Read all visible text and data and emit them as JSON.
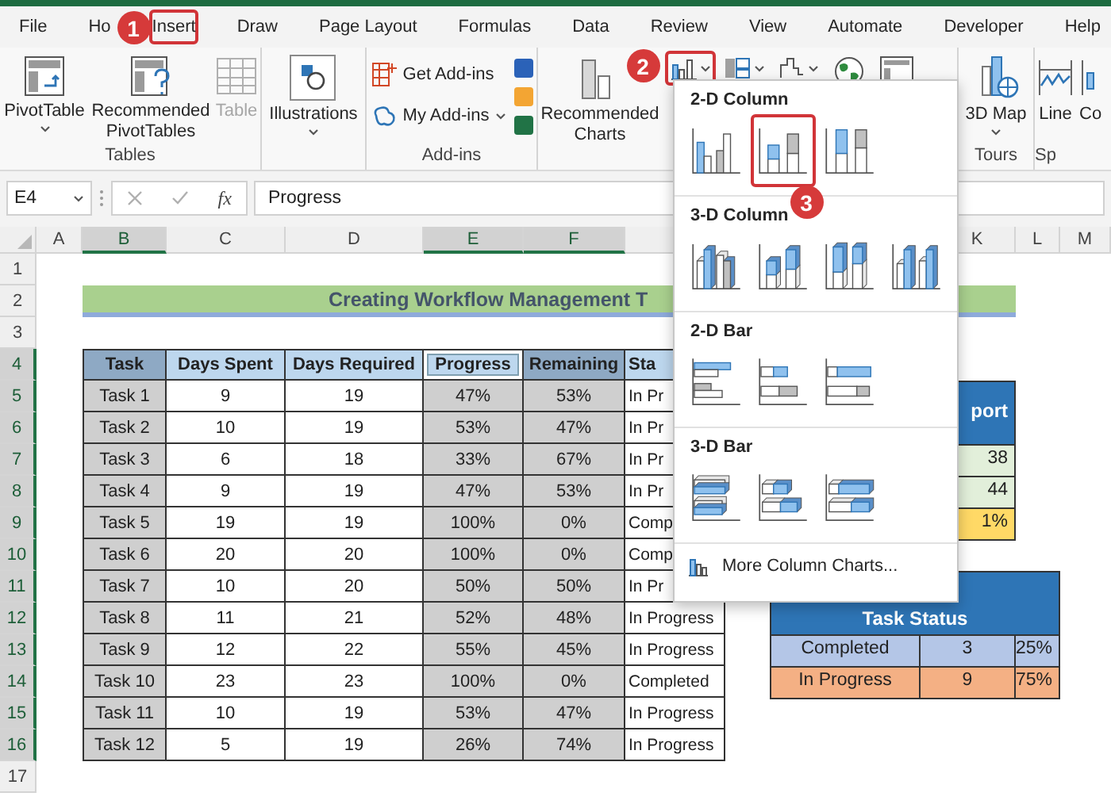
{
  "tabs": [
    {
      "label": "File",
      "selected": false
    },
    {
      "label": "Ho",
      "selected": false
    },
    {
      "label": "Insert",
      "selected": true
    },
    {
      "label": "Draw",
      "selected": false
    },
    {
      "label": "Page Layout",
      "selected": false
    },
    {
      "label": "Formulas",
      "selected": false
    },
    {
      "label": "Data",
      "selected": false
    },
    {
      "label": "Review",
      "selected": false
    },
    {
      "label": "View",
      "selected": false
    },
    {
      "label": "Automate",
      "selected": false
    },
    {
      "label": "Developer",
      "selected": false
    },
    {
      "label": "Help",
      "selected": false
    }
  ],
  "step_badges": [
    "1",
    "2",
    "3"
  ],
  "ribbon": {
    "groups": [
      {
        "kind": "tables",
        "label": "Tables",
        "buttons": [
          {
            "label": "PivotTable",
            "disabled": false
          },
          {
            "label": "Recommended PivotTables",
            "disabled": false
          },
          {
            "label": "Table",
            "disabled": true
          }
        ]
      },
      {
        "kind": "illustrations",
        "buttons": [
          {
            "label": "Illustrations",
            "disabled": false
          }
        ]
      },
      {
        "kind": "addins",
        "label": "Add-ins",
        "buttons": [
          {
            "label": "Get Add-ins",
            "disabled": false
          },
          {
            "label": "My Add-ins",
            "disabled": false
          }
        ]
      },
      {
        "kind": "charts",
        "column_chart_selected": true,
        "buttons": [
          {
            "label": "Recommended Charts",
            "disabled": false
          }
        ]
      },
      {
        "kind": "tours",
        "label": "Tours",
        "buttons": [
          {
            "label": "3D Map",
            "disabled": false
          }
        ]
      },
      {
        "kind": "sparklines",
        "label": "Sp",
        "buttons": [
          {
            "label": "Line",
            "disabled": false
          },
          {
            "label": "Co",
            "disabled": false
          }
        ]
      }
    ]
  },
  "formula_bar": {
    "name_box": "E4",
    "function_label": "fx",
    "formula": "Progress"
  },
  "sheet": {
    "column_headers": [
      {
        "label": "A",
        "selected": false
      },
      {
        "label": "B",
        "selected": true
      },
      {
        "label": "C",
        "selected": false
      },
      {
        "label": "D",
        "selected": false
      },
      {
        "label": "E",
        "selected": true
      },
      {
        "label": "F",
        "selected": true
      },
      {
        "label": "K",
        "selected": false
      },
      {
        "label": "L",
        "selected": false
      },
      {
        "label": "M",
        "selected": false
      }
    ],
    "row_headers": [
      {
        "label": "1",
        "selected": false
      },
      {
        "label": "2",
        "selected": false
      },
      {
        "label": "3",
        "selected": false
      },
      {
        "label": "4",
        "selected": true
      },
      {
        "label": "5",
        "selected": true
      },
      {
        "label": "6",
        "selected": true
      },
      {
        "label": "7",
        "selected": true
      },
      {
        "label": "8",
        "selected": true
      },
      {
        "label": "9",
        "selected": true
      },
      {
        "label": "10",
        "selected": true
      },
      {
        "label": "11",
        "selected": true
      },
      {
        "label": "12",
        "selected": true
      },
      {
        "label": "13",
        "selected": true
      },
      {
        "label": "14",
        "selected": true
      },
      {
        "label": "15",
        "selected": true
      },
      {
        "label": "16",
        "selected": true
      },
      {
        "label": "17",
        "selected": false
      }
    ],
    "title": "Creating Workflow Management T",
    "table": {
      "columns": [
        {
          "label": "Task",
          "selected": true,
          "active": false
        },
        {
          "label": "Days Spent",
          "selected": false,
          "active": false
        },
        {
          "label": "Days Required",
          "selected": false,
          "active": false
        },
        {
          "label": "Progress",
          "selected": true,
          "active": true
        },
        {
          "label": "Remaining",
          "selected": true,
          "active": false
        },
        {
          "label": "Sta",
          "selected": false,
          "active": false
        }
      ],
      "rows": [
        [
          "Task 1",
          "9",
          "19",
          "47%",
          "53%",
          "In Pr"
        ],
        [
          "Task 2",
          "10",
          "19",
          "53%",
          "47%",
          "In Pr"
        ],
        [
          "Task 3",
          "6",
          "18",
          "33%",
          "67%",
          "In Pr"
        ],
        [
          "Task 4",
          "9",
          "19",
          "47%",
          "53%",
          "In Pr"
        ],
        [
          "Task 5",
          "19",
          "19",
          "100%",
          "0%",
          "Comp"
        ],
        [
          "Task 6",
          "20",
          "20",
          "100%",
          "0%",
          "Comp"
        ],
        [
          "Task 7",
          "10",
          "20",
          "50%",
          "50%",
          "In Pr"
        ],
        [
          "Task 8",
          "11",
          "21",
          "52%",
          "48%",
          "In Progress"
        ],
        [
          "Task 9",
          "12",
          "22",
          "55%",
          "45%",
          "In Progress"
        ],
        [
          "Task 10",
          "23",
          "23",
          "100%",
          "0%",
          "Completed"
        ],
        [
          "Task 11",
          "10",
          "19",
          "53%",
          "47%",
          "In Progress"
        ],
        [
          "Task 12",
          "5",
          "19",
          "26%",
          "74%",
          "In Progress"
        ]
      ]
    },
    "report": {
      "header": "port",
      "rows": [
        {
          "value": "38",
          "color": "#e2efda"
        },
        {
          "value": "44",
          "color": "#e2efda"
        },
        {
          "value": "1%",
          "color": "#ffd966"
        }
      ]
    },
    "task_status": {
      "header": "Task Status",
      "rows": [
        {
          "label": "Completed",
          "count": "3",
          "share": "25%",
          "color": "#b4c6e7"
        },
        {
          "label": "In Progress",
          "count": "9",
          "share": "75%",
          "color": "#f4b084"
        }
      ]
    }
  },
  "chart_menu": {
    "sections": [
      {
        "title": "2-D Column",
        "charts": [
          {
            "kind": "colClustered",
            "selected": false
          },
          {
            "kind": "colStacked",
            "selected": true
          },
          {
            "kind": "colFull",
            "selected": false
          }
        ]
      },
      {
        "title": "3-D Column",
        "charts": [
          {
            "kind": "colClustered3d",
            "selected": false
          },
          {
            "kind": "colStacked3d",
            "selected": false
          },
          {
            "kind": "colFull3d",
            "selected": false
          },
          {
            "kind": "col3d",
            "selected": false
          }
        ]
      },
      {
        "title": "2-D Bar",
        "charts": [
          {
            "kind": "barClustered",
            "selected": false
          },
          {
            "kind": "barStacked",
            "selected": false
          },
          {
            "kind": "barFull",
            "selected": false
          }
        ]
      },
      {
        "title": "3-D Bar",
        "charts": [
          {
            "kind": "barClustered3d",
            "selected": false
          },
          {
            "kind": "barStacked3d",
            "selected": false
          },
          {
            "kind": "barFull3d",
            "selected": false
          }
        ]
      }
    ],
    "more": "More Column Charts..."
  }
}
